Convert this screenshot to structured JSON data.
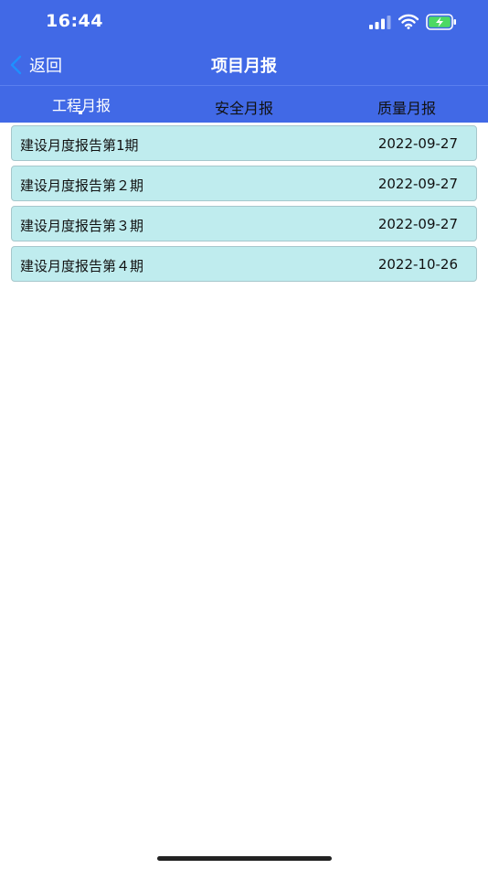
{
  "status_bar": {
    "time": "16:44"
  },
  "nav": {
    "back_label": "返回",
    "title": "项目月报"
  },
  "tabs": [
    {
      "label": "工程月报",
      "active": true
    },
    {
      "label": "安全月报",
      "active": false
    },
    {
      "label": "质量月报",
      "active": false
    }
  ],
  "reports": [
    {
      "name": "建设月度报告第1期",
      "date": "2022-09-27"
    },
    {
      "name": "建设月度报告第２期",
      "date": "2022-09-27"
    },
    {
      "name": "建设月度报告第３期",
      "date": "2022-09-27"
    },
    {
      "name": "建设月度报告第４期",
      "date": "2022-10-26"
    }
  ],
  "colors": {
    "header_bg": "#4169e6",
    "row_bg": "#bfecee",
    "row_border": "#a6c7cc",
    "battery_fill": "#4cd964"
  }
}
